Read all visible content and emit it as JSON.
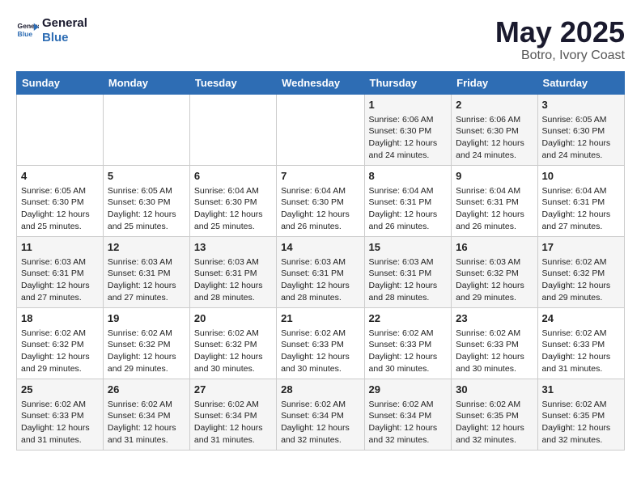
{
  "header": {
    "logo_line1": "General",
    "logo_line2": "Blue",
    "month_year": "May 2025",
    "location": "Botro, Ivory Coast"
  },
  "weekdays": [
    "Sunday",
    "Monday",
    "Tuesday",
    "Wednesday",
    "Thursday",
    "Friday",
    "Saturday"
  ],
  "weeks": [
    [
      {
        "day": "",
        "info": ""
      },
      {
        "day": "",
        "info": ""
      },
      {
        "day": "",
        "info": ""
      },
      {
        "day": "",
        "info": ""
      },
      {
        "day": "1",
        "info": "Sunrise: 6:06 AM\nSunset: 6:30 PM\nDaylight: 12 hours\nand 24 minutes."
      },
      {
        "day": "2",
        "info": "Sunrise: 6:06 AM\nSunset: 6:30 PM\nDaylight: 12 hours\nand 24 minutes."
      },
      {
        "day": "3",
        "info": "Sunrise: 6:05 AM\nSunset: 6:30 PM\nDaylight: 12 hours\nand 24 minutes."
      }
    ],
    [
      {
        "day": "4",
        "info": "Sunrise: 6:05 AM\nSunset: 6:30 PM\nDaylight: 12 hours\nand 25 minutes."
      },
      {
        "day": "5",
        "info": "Sunrise: 6:05 AM\nSunset: 6:30 PM\nDaylight: 12 hours\nand 25 minutes."
      },
      {
        "day": "6",
        "info": "Sunrise: 6:04 AM\nSunset: 6:30 PM\nDaylight: 12 hours\nand 25 minutes."
      },
      {
        "day": "7",
        "info": "Sunrise: 6:04 AM\nSunset: 6:30 PM\nDaylight: 12 hours\nand 26 minutes."
      },
      {
        "day": "8",
        "info": "Sunrise: 6:04 AM\nSunset: 6:31 PM\nDaylight: 12 hours\nand 26 minutes."
      },
      {
        "day": "9",
        "info": "Sunrise: 6:04 AM\nSunset: 6:31 PM\nDaylight: 12 hours\nand 26 minutes."
      },
      {
        "day": "10",
        "info": "Sunrise: 6:04 AM\nSunset: 6:31 PM\nDaylight: 12 hours\nand 27 minutes."
      }
    ],
    [
      {
        "day": "11",
        "info": "Sunrise: 6:03 AM\nSunset: 6:31 PM\nDaylight: 12 hours\nand 27 minutes."
      },
      {
        "day": "12",
        "info": "Sunrise: 6:03 AM\nSunset: 6:31 PM\nDaylight: 12 hours\nand 27 minutes."
      },
      {
        "day": "13",
        "info": "Sunrise: 6:03 AM\nSunset: 6:31 PM\nDaylight: 12 hours\nand 28 minutes."
      },
      {
        "day": "14",
        "info": "Sunrise: 6:03 AM\nSunset: 6:31 PM\nDaylight: 12 hours\nand 28 minutes."
      },
      {
        "day": "15",
        "info": "Sunrise: 6:03 AM\nSunset: 6:31 PM\nDaylight: 12 hours\nand 28 minutes."
      },
      {
        "day": "16",
        "info": "Sunrise: 6:03 AM\nSunset: 6:32 PM\nDaylight: 12 hours\nand 29 minutes."
      },
      {
        "day": "17",
        "info": "Sunrise: 6:02 AM\nSunset: 6:32 PM\nDaylight: 12 hours\nand 29 minutes."
      }
    ],
    [
      {
        "day": "18",
        "info": "Sunrise: 6:02 AM\nSunset: 6:32 PM\nDaylight: 12 hours\nand 29 minutes."
      },
      {
        "day": "19",
        "info": "Sunrise: 6:02 AM\nSunset: 6:32 PM\nDaylight: 12 hours\nand 29 minutes."
      },
      {
        "day": "20",
        "info": "Sunrise: 6:02 AM\nSunset: 6:32 PM\nDaylight: 12 hours\nand 30 minutes."
      },
      {
        "day": "21",
        "info": "Sunrise: 6:02 AM\nSunset: 6:33 PM\nDaylight: 12 hours\nand 30 minutes."
      },
      {
        "day": "22",
        "info": "Sunrise: 6:02 AM\nSunset: 6:33 PM\nDaylight: 12 hours\nand 30 minutes."
      },
      {
        "day": "23",
        "info": "Sunrise: 6:02 AM\nSunset: 6:33 PM\nDaylight: 12 hours\nand 30 minutes."
      },
      {
        "day": "24",
        "info": "Sunrise: 6:02 AM\nSunset: 6:33 PM\nDaylight: 12 hours\nand 31 minutes."
      }
    ],
    [
      {
        "day": "25",
        "info": "Sunrise: 6:02 AM\nSunset: 6:33 PM\nDaylight: 12 hours\nand 31 minutes."
      },
      {
        "day": "26",
        "info": "Sunrise: 6:02 AM\nSunset: 6:34 PM\nDaylight: 12 hours\nand 31 minutes."
      },
      {
        "day": "27",
        "info": "Sunrise: 6:02 AM\nSunset: 6:34 PM\nDaylight: 12 hours\nand 31 minutes."
      },
      {
        "day": "28",
        "info": "Sunrise: 6:02 AM\nSunset: 6:34 PM\nDaylight: 12 hours\nand 32 minutes."
      },
      {
        "day": "29",
        "info": "Sunrise: 6:02 AM\nSunset: 6:34 PM\nDaylight: 12 hours\nand 32 minutes."
      },
      {
        "day": "30",
        "info": "Sunrise: 6:02 AM\nSunset: 6:35 PM\nDaylight: 12 hours\nand 32 minutes."
      },
      {
        "day": "31",
        "info": "Sunrise: 6:02 AM\nSunset: 6:35 PM\nDaylight: 12 hours\nand 32 minutes."
      }
    ]
  ]
}
